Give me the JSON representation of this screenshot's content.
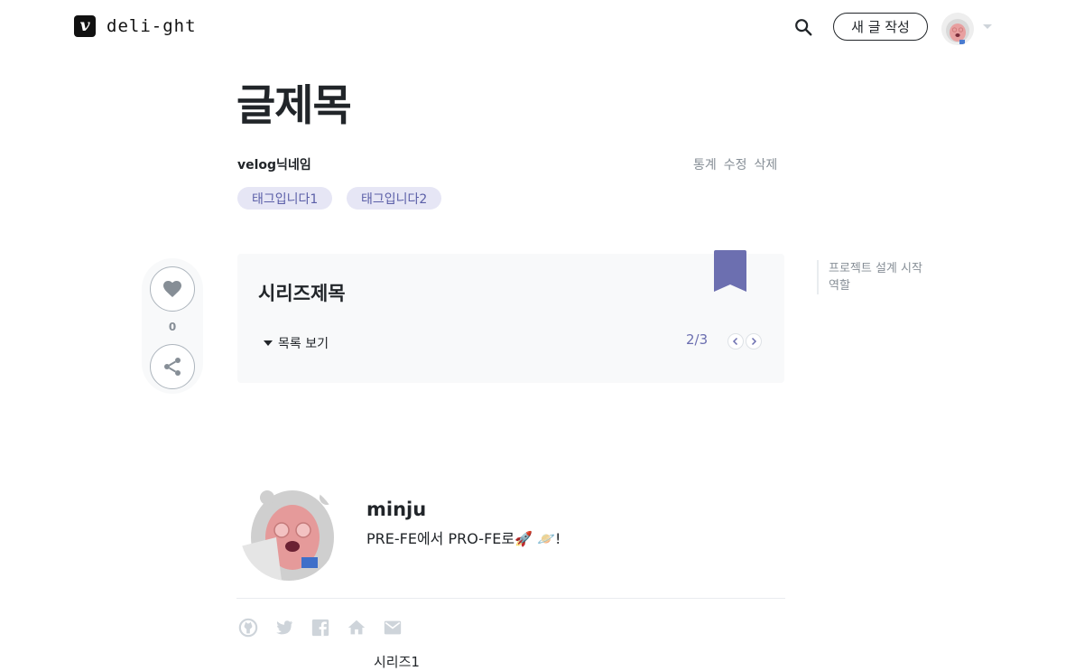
{
  "header": {
    "logo_glyph": "v",
    "blog_name": "deli-ght",
    "new_post_label": "새 글 작성"
  },
  "post": {
    "title": "글제목",
    "author": "velog닉네임",
    "actions": [
      "통계",
      "수정",
      "삭제"
    ],
    "tags": [
      "태그입니다1",
      "태그입니다2"
    ]
  },
  "series": {
    "title": "시리즈제목",
    "toggle_label": "목록 보기",
    "counter": "2/3"
  },
  "likes": {
    "count": "0"
  },
  "toc": {
    "items": [
      "프로젝트 설계 시작",
      "역할"
    ]
  },
  "profile": {
    "name": "minju",
    "bio": "PRE-FE에서 PRO-FE로🚀 🪐!"
  },
  "bottom": {
    "text": "시리즈1"
  },
  "colors": {
    "accent": "#6c6fb0",
    "tag_bg": "#e6e6f5",
    "tag_text": "#5b5fa8"
  }
}
